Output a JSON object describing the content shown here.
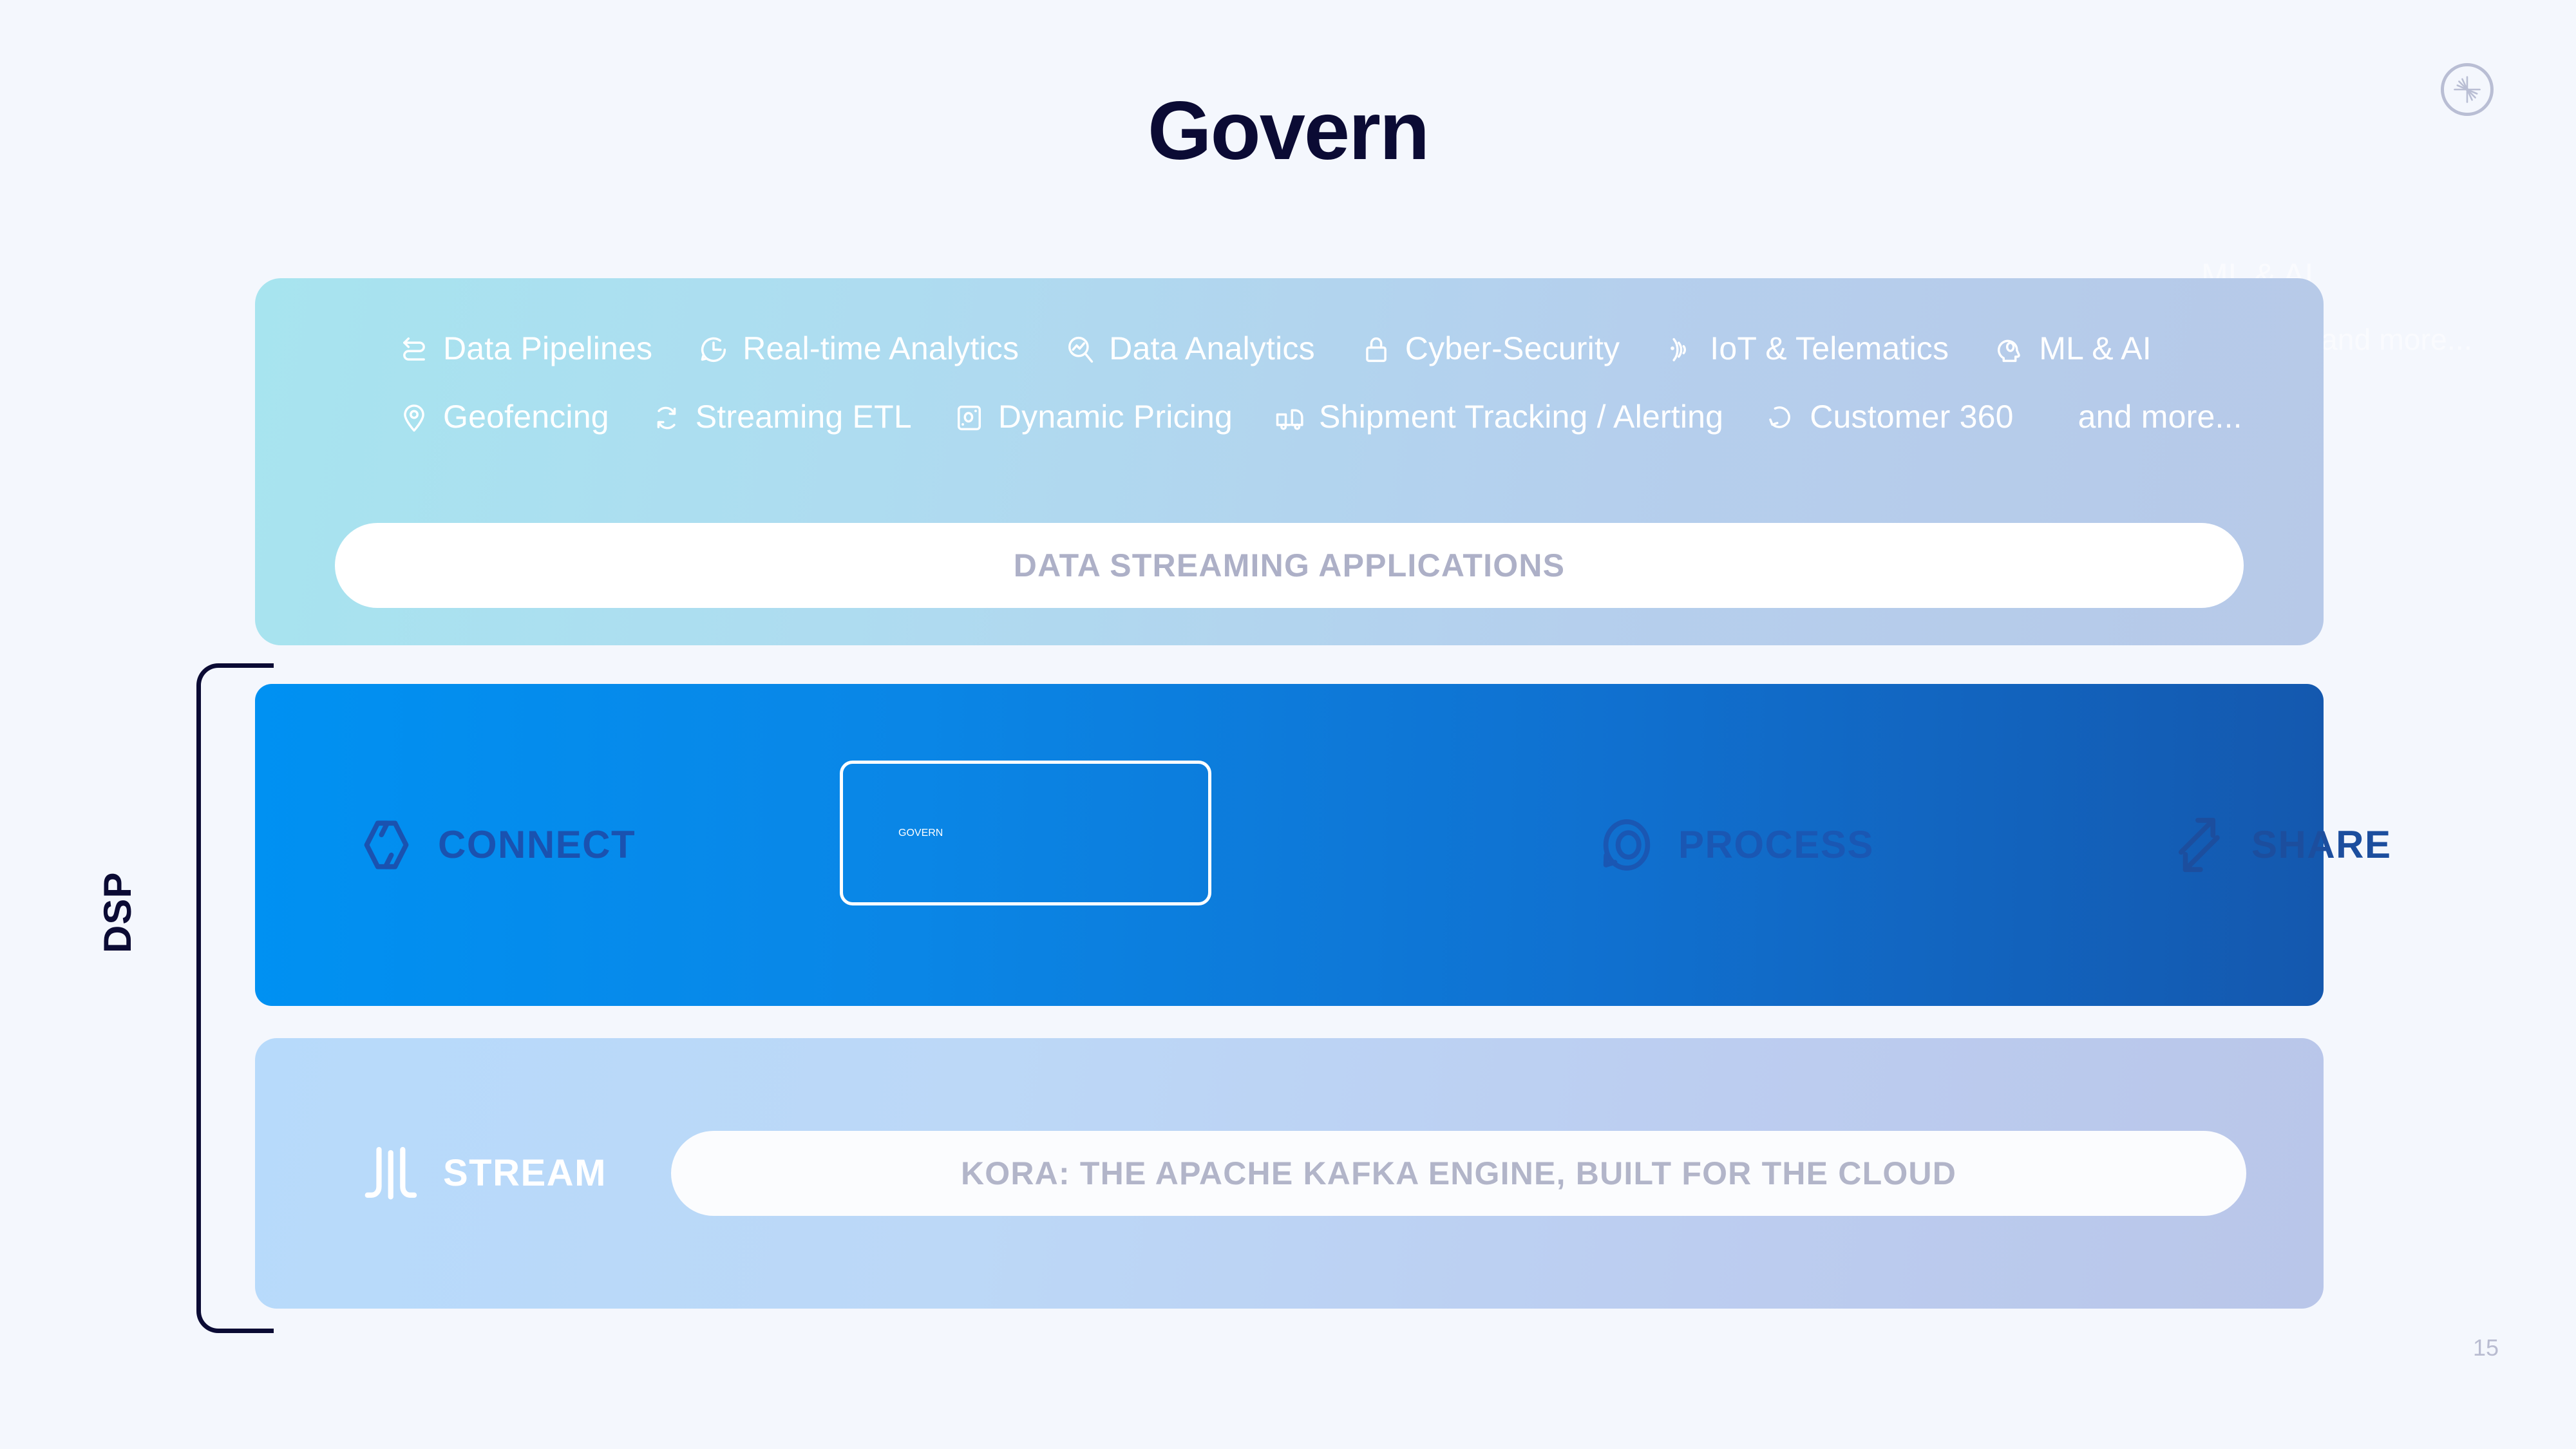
{
  "slide": {
    "title": "Govern",
    "page_number": "15",
    "brand_icon": "confluent-logo-icon"
  },
  "ghosts": [
    {
      "text": "ML & AI"
    },
    {
      "text": "and more..."
    },
    {
      "text": "..."
    }
  ],
  "apps_card": {
    "row1": [
      {
        "label": "Data Pipelines",
        "icon": "data-pipelines-icon"
      },
      {
        "label": "Real-time Analytics",
        "icon": "realtime-analytics-icon"
      },
      {
        "label": "Data Analytics",
        "icon": "data-analytics-icon"
      },
      {
        "label": "Cyber-Security",
        "icon": "lock-icon"
      },
      {
        "label": "IoT & Telematics",
        "icon": "signal-icon"
      },
      {
        "label": "ML & AI",
        "icon": "ml-ai-head-icon"
      }
    ],
    "row2": [
      {
        "label": "Geofencing",
        "icon": "map-pin-icon"
      },
      {
        "label": "Streaming ETL",
        "icon": "refresh-cycle-icon"
      },
      {
        "label": "Dynamic Pricing",
        "icon": "price-tag-icon"
      },
      {
        "label": "Shipment Tracking / Alerting",
        "icon": "truck-icon"
      },
      {
        "label": "Customer 360",
        "icon": "customer-360-icon"
      },
      {
        "label": "and more...",
        "icon": ""
      }
    ],
    "banner_label": "DATA STREAMING APPLICATIONS"
  },
  "dsp": {
    "bracket_label": "DSP",
    "stages": [
      {
        "label": "CONNECT",
        "icon": "hexagon-connect-icon",
        "active": false
      },
      {
        "label": "GOVERN",
        "icon": "shield-search-icon",
        "active": true
      },
      {
        "label": "PROCESS",
        "icon": "process-loop-icon",
        "active": false
      },
      {
        "label": "SHARE",
        "icon": "share-arrows-icon",
        "active": false
      }
    ]
  },
  "stream": {
    "label": "STREAM",
    "icon": "kafka-stream-icon",
    "banner_label": "KORA: THE APACHE KAFKA ENGINE, BUILT FOR THE CLOUD"
  },
  "colors": {
    "background": "#f4f7fd",
    "title": "#0b0b34",
    "apps_card_from": "#a7e4ef",
    "apps_card_to": "#b7c9e8",
    "dsp_band_from": "#0091f2",
    "dsp_band_to": "#1458ae",
    "dsp_dim_text": "#1a52b0",
    "active_text": "#ffffff",
    "stream_card_from": "#b7dafb",
    "stream_card_to": "#b9c6e9",
    "banner_text": "#adb0c7"
  }
}
